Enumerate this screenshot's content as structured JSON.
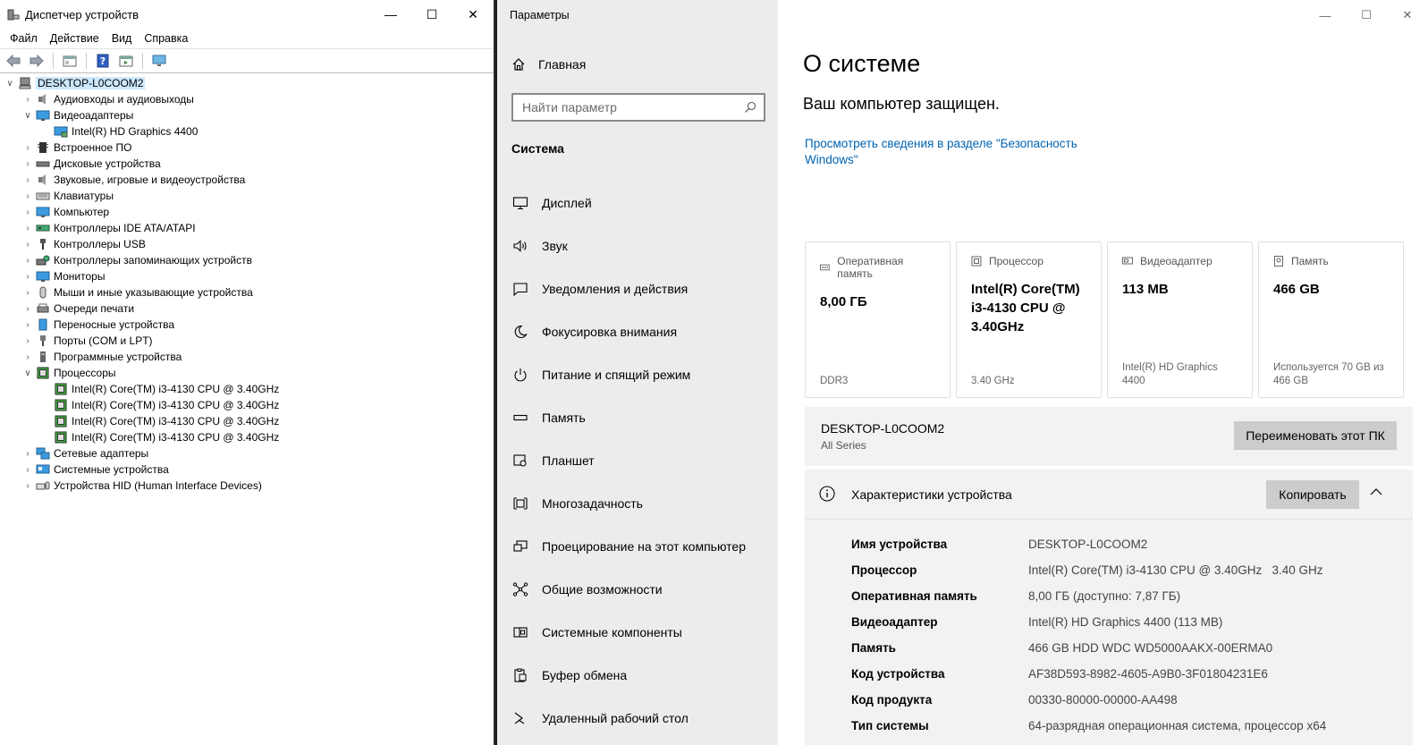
{
  "device_manager": {
    "title": "Диспетчер устройств",
    "menu": [
      "Файл",
      "Действие",
      "Вид",
      "Справка"
    ],
    "tree": {
      "root": "DESKTOP-L0COOM2",
      "nodes": [
        {
          "label": "Аудиовходы и аудиовыходы",
          "expanded": false,
          "icon": "speaker-icon"
        },
        {
          "label": "Видеоадаптеры",
          "expanded": true,
          "icon": "display-adapter-icon",
          "children": [
            "Intel(R) HD Graphics 4400"
          ]
        },
        {
          "label": "Встроенное ПО",
          "expanded": false,
          "icon": "firmware-icon"
        },
        {
          "label": "Дисковые устройства",
          "expanded": false,
          "icon": "disk-icon"
        },
        {
          "label": "Звуковые, игровые и видеоустройства",
          "expanded": false,
          "icon": "speaker-icon"
        },
        {
          "label": "Клавиатуры",
          "expanded": false,
          "icon": "keyboard-icon"
        },
        {
          "label": "Компьютер",
          "expanded": false,
          "icon": "monitor-icon"
        },
        {
          "label": "Контроллеры IDE ATA/ATAPI",
          "expanded": false,
          "icon": "ide-controller-icon"
        },
        {
          "label": "Контроллеры USB",
          "expanded": false,
          "icon": "usb-icon"
        },
        {
          "label": "Контроллеры запоминающих устройств",
          "expanded": false,
          "icon": "storage-controller-icon"
        },
        {
          "label": "Мониторы",
          "expanded": false,
          "icon": "monitor-icon"
        },
        {
          "label": "Мыши и иные указывающие устройства",
          "expanded": false,
          "icon": "mouse-icon"
        },
        {
          "label": "Очереди печати",
          "expanded": false,
          "icon": "printer-icon"
        },
        {
          "label": "Переносные устройства",
          "expanded": false,
          "icon": "portable-device-icon"
        },
        {
          "label": "Порты (COM и LPT)",
          "expanded": false,
          "icon": "port-icon"
        },
        {
          "label": "Программные устройства",
          "expanded": false,
          "icon": "software-device-icon"
        },
        {
          "label": "Процессоры",
          "expanded": true,
          "icon": "cpu-icon",
          "children": [
            "Intel(R) Core(TM) i3-4130 CPU @ 3.40GHz",
            "Intel(R) Core(TM) i3-4130 CPU @ 3.40GHz",
            "Intel(R) Core(TM) i3-4130 CPU @ 3.40GHz",
            "Intel(R) Core(TM) i3-4130 CPU @ 3.40GHz"
          ]
        },
        {
          "label": "Сетевые адаптеры",
          "expanded": false,
          "icon": "network-icon"
        },
        {
          "label": "Системные устройства",
          "expanded": false,
          "icon": "system-device-icon"
        },
        {
          "label": "Устройства HID (Human Interface Devices)",
          "expanded": false,
          "icon": "hid-icon"
        }
      ]
    }
  },
  "settings": {
    "window_title": "Параметры",
    "home_label": "Главная",
    "search_placeholder": "Найти параметр",
    "section_label": "Система",
    "nav_items": [
      {
        "label": "Дисплей",
        "icon": "display-icon"
      },
      {
        "label": "Звук",
        "icon": "sound-icon"
      },
      {
        "label": "Уведомления и действия",
        "icon": "notifications-icon"
      },
      {
        "label": "Фокусировка внимания",
        "icon": "focus-moon-icon"
      },
      {
        "label": "Питание и спящий режим",
        "icon": "power-icon"
      },
      {
        "label": "Память",
        "icon": "storage-icon"
      },
      {
        "label": "Планшет",
        "icon": "tablet-icon"
      },
      {
        "label": "Многозадачность",
        "icon": "multitasking-icon"
      },
      {
        "label": "Проецирование на этот компьютер",
        "icon": "projecting-icon"
      },
      {
        "label": "Общие возможности",
        "icon": "shared-experiences-icon"
      },
      {
        "label": "Системные компоненты",
        "icon": "system-components-icon"
      },
      {
        "label": "Буфер обмена",
        "icon": "clipboard-icon"
      },
      {
        "label": "Удаленный рабочий стол",
        "icon": "remote-desktop-icon"
      }
    ],
    "page_title": "О системе",
    "protected_text": "Ваш компьютер защищен.",
    "security_link": "Просмотреть сведения в разделе \"Безопасность Windows\"",
    "cards": [
      {
        "title": "Оперативная память",
        "value": "8,00 ГБ",
        "sub": "DDR3",
        "icon": "ram-icon"
      },
      {
        "title": "Процессор",
        "value": "Intel(R) Core(TM) i3-4130 CPU @ 3.40GHz",
        "sub": "3.40 GHz",
        "icon": "processor-icon"
      },
      {
        "title": "Видеоадаптер",
        "value": "113 MB",
        "sub": "Intel(R) HD Graphics 4400",
        "icon": "gpu-icon"
      },
      {
        "title": "Память",
        "value": "466 GB",
        "sub": "Используется 70 GB из 466 GB",
        "icon": "storage-card-icon"
      }
    ],
    "device_name": "DESKTOP-L0COOM2",
    "device_series": "All Series",
    "rename_button": "Переименовать этот ПК",
    "specs_title": "Характеристики устройства",
    "copy_button": "Копировать",
    "specs": [
      {
        "label": "Имя устройства",
        "value": "DESKTOP-L0COOM2"
      },
      {
        "label": "Процессор",
        "value": "Intel(R) Core(TM) i3-4130 CPU @ 3.40GHz   3.40 GHz"
      },
      {
        "label": "Оперативная память",
        "value": "8,00 ГБ (доступно: 7,87 ГБ)"
      },
      {
        "label": "Видеоадаптер",
        "value": "Intel(R) HD Graphics 4400 (113 MB)"
      },
      {
        "label": "Память",
        "value": "466 GB HDD WDC WD5000AAKX-00ERMA0"
      },
      {
        "label": "Код устройства",
        "value": "AF38D593-8982-4605-A9B0-3F01804231E6"
      },
      {
        "label": "Код продукта",
        "value": "00330-80000-00000-AA498"
      },
      {
        "label": "Тип системы",
        "value": "64-разрядная операционная система, процессор x64"
      }
    ]
  },
  "colors": {
    "link": "#0063b1",
    "selection": "#cce8ff",
    "nav_bg": "#ececec",
    "panel_bg": "#f2f2f2"
  }
}
